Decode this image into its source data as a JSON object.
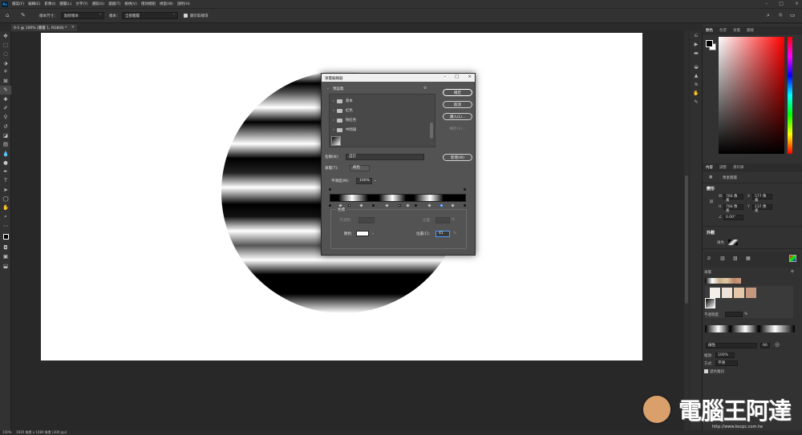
{
  "menubar": {
    "app_icon": "Ps",
    "items": [
      "檔案(F)",
      "編輯(E)",
      "影像(I)",
      "圖層(L)",
      "文字(Y)",
      "選取(S)",
      "濾鏡(T)",
      "檢視(V)",
      "增效模組",
      "視窗(W)",
      "說明(H)"
    ]
  },
  "options": {
    "sample_size_label": "樣本尺寸：",
    "sample_size_value": "點狀樣本",
    "sample_label": "樣本：",
    "sample_value": "全部圖層",
    "show_ring_label": "顯示取樣環"
  },
  "document": {
    "tab_title": "0-1 @ 100% (圖層 1, RGB/8) *",
    "close": "×"
  },
  "dialog": {
    "title": "漸層編輯器",
    "presets_label": "預設集",
    "preset_folders": [
      "基本",
      "紅色",
      "粉紅色",
      "中間調"
    ],
    "buttons": {
      "ok": "確定",
      "cancel": "取消",
      "load": "讀入(L)...",
      "save": "轉存(V)...",
      "new": "新增(W)"
    },
    "name_label": "名稱(N):",
    "name_value": "自訂",
    "type_label": "漸層(T):",
    "type_value": "純色",
    "smoothness_label": "平滑度(M):",
    "smoothness_value": "100%",
    "stops_label": "色標",
    "opacity_label": "不透明:",
    "location_label": "位置:",
    "color_label": "顏色:",
    "color_location_label": "位置(C):",
    "color_location_value": "41",
    "percent": "%",
    "delete_label": "刪除"
  },
  "panels": {
    "color_tabs": [
      "顏色",
      "色票",
      "漸層",
      "圖樣"
    ],
    "props_tabs": [
      "內容",
      "調整",
      "資料庫"
    ],
    "pixel_layer": "像素圖層",
    "transform_title": "變形",
    "w_label": "W",
    "w_value": "766 像素",
    "h_label": "H",
    "h_value": "766 像素",
    "x_label": "X",
    "x_value": "577 像素",
    "y_label": "Y",
    "y_value": "137 像素",
    "angle_value": "0.00°",
    "appearance_title": "外觀",
    "fill_label": "填色",
    "gradient_title": "漸層",
    "opacity_label": "不透明度",
    "percent": "%",
    "style_value": "線性",
    "angle_field": "90",
    "scale_label": "縮放:",
    "scale_value": "100%",
    "method_label": "方式:",
    "method_value": "平滑",
    "dither_label": "遞色雜訊"
  },
  "statusbar": {
    "zoom": "100%",
    "doc_info": "1920 像素 x 1080 像素 (300 ppi)"
  },
  "watermark": {
    "title": "電腦王阿達",
    "url": "http://www.kocpc.com.tw"
  }
}
